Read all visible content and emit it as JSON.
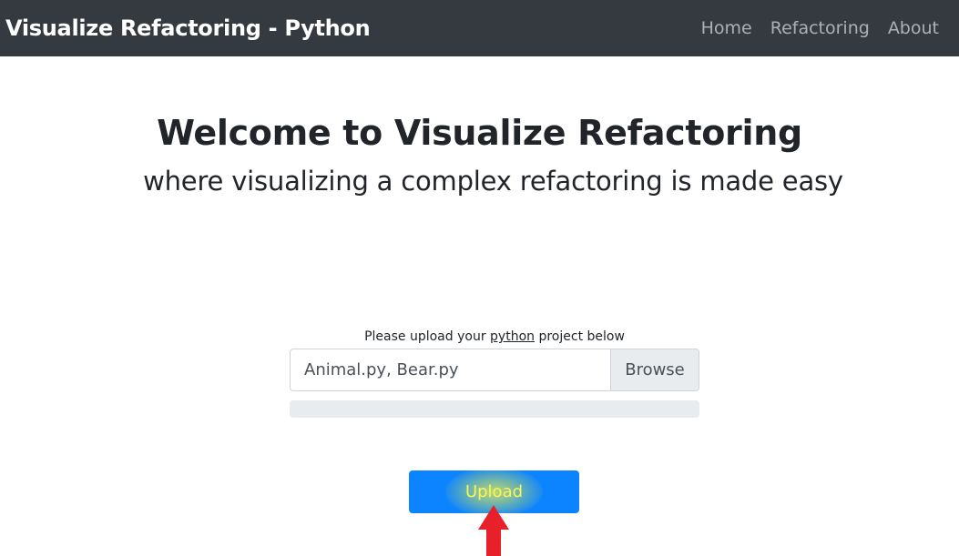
{
  "navbar": {
    "brand": "Visualize Refactoring - Python",
    "links": [
      "Home",
      "Refactoring",
      "About"
    ]
  },
  "hero": {
    "title": "Welcome to Visualize Refactoring",
    "subtitle": "where visualizing a complex refactoring is made easy"
  },
  "upload": {
    "label_prefix": "Please upload your ",
    "label_lang": "python",
    "label_suffix": " project below",
    "file_value": "Animal.py, Bear.py",
    "browse_label": "Browse",
    "progress_percent": 0,
    "button_label": "Upload"
  },
  "colors": {
    "navbar_bg": "#343a40",
    "primary": "#0d84ff",
    "highlight_text": "#fbf35a",
    "arrow": "#e8202a"
  },
  "icons": {
    "annotation": "up-arrow-icon"
  }
}
